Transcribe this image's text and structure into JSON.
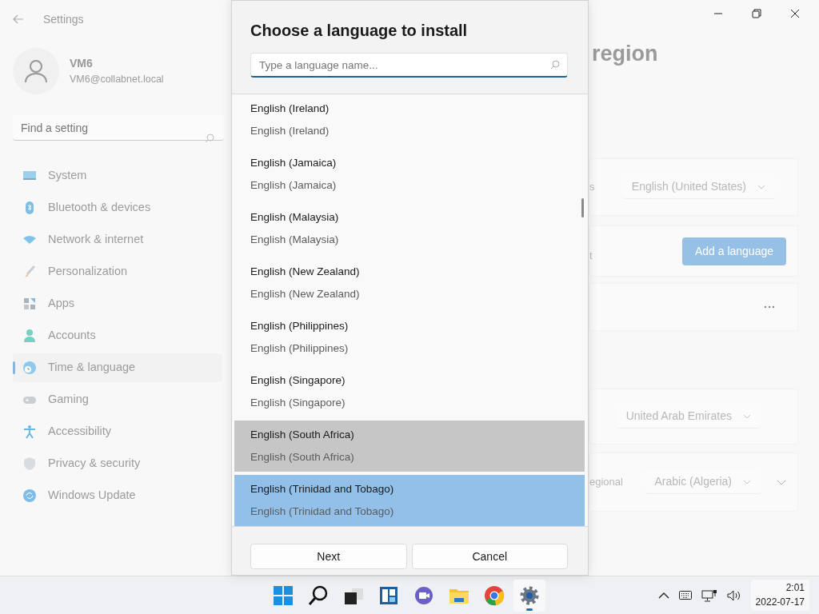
{
  "settings_window": {
    "title": "Settings",
    "user": {
      "name": "VM6",
      "email": "VM6@collabnet.local"
    },
    "search": {
      "placeholder": "Find a setting"
    },
    "nav": [
      {
        "label": "System",
        "kind": "system",
        "selected": false
      },
      {
        "label": "Bluetooth & devices",
        "kind": "bluetooth",
        "selected": false
      },
      {
        "label": "Network & internet",
        "kind": "network",
        "selected": false
      },
      {
        "label": "Personalization",
        "kind": "brush",
        "selected": false
      },
      {
        "label": "Apps",
        "kind": "apps",
        "selected": false
      },
      {
        "label": "Accounts",
        "kind": "account",
        "selected": false
      },
      {
        "label": "Time & language",
        "kind": "time",
        "selected": true
      },
      {
        "label": "Gaming",
        "kind": "gaming",
        "selected": false
      },
      {
        "label": "Accessibility",
        "kind": "accessibility",
        "selected": false
      },
      {
        "label": "Privacy & security",
        "kind": "shield",
        "selected": false
      },
      {
        "label": "Windows Update",
        "kind": "update",
        "selected": false
      }
    ],
    "page_title": "region",
    "cards": [
      {
        "kind": "dropdown",
        "label": "s",
        "value": "English (United States)"
      },
      {
        "kind": "button",
        "label": "t",
        "button": "Add a language"
      },
      {
        "kind": "more"
      },
      {
        "kind": "dropdown",
        "value": "United Arab Emirates"
      },
      {
        "kind": "dropdown",
        "label": "egional",
        "value": "Arabic (Algeria)",
        "expandable": true
      }
    ]
  },
  "dialog": {
    "title": "Choose a language to install",
    "search": {
      "placeholder": "Type a language name..."
    },
    "languages": [
      {
        "name": "English (Ireland)",
        "native": "English (Ireland)",
        "selected": false,
        "hovered": false
      },
      {
        "name": "English (Jamaica)",
        "native": "English (Jamaica)",
        "selected": false,
        "hovered": false
      },
      {
        "name": "English (Malaysia)",
        "native": "English (Malaysia)",
        "selected": false,
        "hovered": false
      },
      {
        "name": "English (New Zealand)",
        "native": "English (New Zealand)",
        "selected": false,
        "hovered": false
      },
      {
        "name": "English (Philippines)",
        "native": "English (Philippines)",
        "selected": false,
        "hovered": false
      },
      {
        "name": "English (Singapore)",
        "native": "English (Singapore)",
        "selected": false,
        "hovered": false
      },
      {
        "name": "English (South Africa)",
        "native": "English (South Africa)",
        "selected": false,
        "hovered": true
      },
      {
        "name": "English (Trinidad and Tobago)",
        "native": "English (Trinidad and Tobago)",
        "selected": true,
        "hovered": false
      }
    ],
    "buttons": [
      {
        "label": "Next"
      },
      {
        "label": "Cancel"
      }
    ]
  },
  "taskbar": {
    "apps": [
      {
        "kind": "start",
        "active": false
      },
      {
        "kind": "search",
        "active": false
      },
      {
        "kind": "taskview",
        "active": false
      },
      {
        "kind": "widgets",
        "active": false
      },
      {
        "kind": "chat",
        "active": false
      },
      {
        "kind": "folder",
        "active": false
      },
      {
        "kind": "browser",
        "active": false
      },
      {
        "kind": "gear",
        "active": true
      }
    ],
    "clock": {
      "time": "2:01",
      "date": "2022-07-17"
    }
  }
}
